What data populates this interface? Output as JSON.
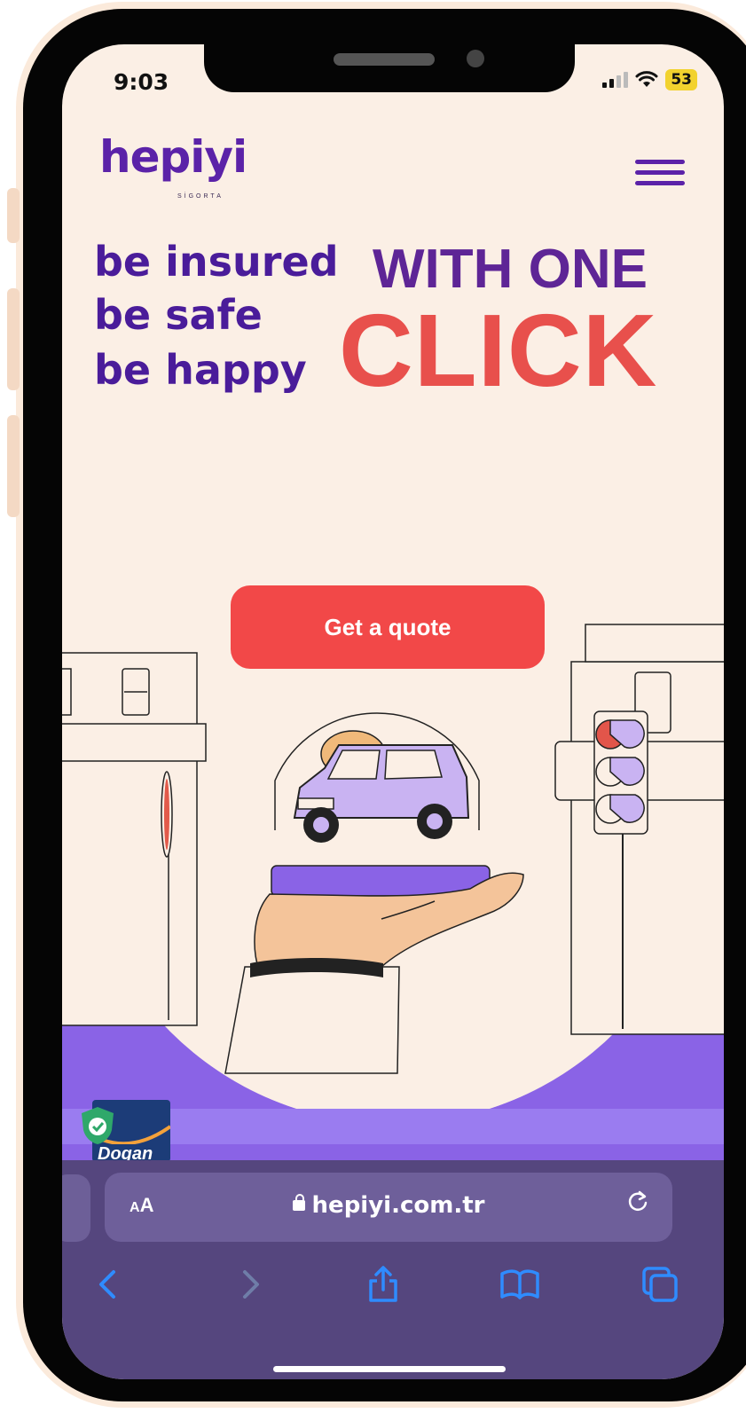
{
  "status": {
    "time": "9:03",
    "battery": "53"
  },
  "brand": {
    "logo": "hepiyi",
    "logo_sub": "SİGORTA"
  },
  "hero": {
    "line1": "be insured",
    "line2": "be safe",
    "line3": "be happy",
    "headline1": "WITH ONE",
    "headline2": "CLICK",
    "cta": "Get a quote"
  },
  "trust_badge": {
    "text": "Dogan"
  },
  "browser": {
    "aa_small": "A",
    "aa_big": "A",
    "url": "hepiyi.com.tr"
  },
  "colors": {
    "brand_purple": "#5b22a8",
    "accent_red": "#f24848",
    "click_red": "#e8504c",
    "band_purple": "#8a63e6",
    "page_bg": "#fbefe5",
    "browser_bg": "#55467e",
    "ios_blue": "#2f8cff"
  },
  "icons": [
    "menu-icon",
    "lock-icon",
    "reload-icon",
    "back-icon",
    "forward-icon",
    "share-icon",
    "bookmarks-icon",
    "tabs-icon",
    "shield-check-icon"
  ]
}
